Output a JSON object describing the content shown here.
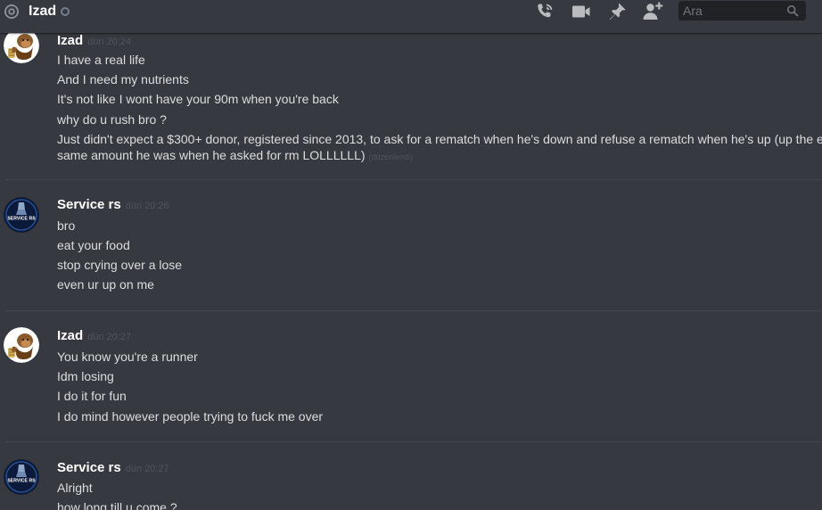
{
  "header": {
    "channel_name": "Izad",
    "status": "offline",
    "search_placeholder": "Ara",
    "icons": [
      "at-icon",
      "voice-call-icon",
      "video-call-icon",
      "pin-icon",
      "add-friend-icon",
      "search-icon"
    ]
  },
  "colors": {
    "background": "#36393f",
    "header_text": "#ffffff",
    "message_text": "#dcddde",
    "timestamp": "#4f545c",
    "icon": "#b9bbbe",
    "search_bg": "#202225"
  },
  "messages": [
    {
      "author": "Izad",
      "avatar": "ape-avatar",
      "timestamp": "dün 20:24",
      "lines": [
        "I have a real life",
        "And I need my nutrients",
        "It's not like I wont have your 90m when you're back",
        "why do u rush bro ?",
        "Just didn't expect a $300+ donor, registered since 2013, to ask for a rematch when he's down and refuse a rematch when he's up (up the e",
        "same amount he was when he asked for rm LOLLLLLL)"
      ],
      "edited_label": "(düzenlendi)"
    },
    {
      "author": "Service rs",
      "avatar": "service-rs-avatar",
      "avatar_text": "SERVICE RS",
      "timestamp": "dün 20:26",
      "lines": [
        "bro",
        "eat your food",
        "stop crying over a lose",
        "even ur up on me"
      ]
    },
    {
      "author": "Izad",
      "avatar": "ape-avatar",
      "timestamp": "dün 20:27",
      "lines": [
        "You know you're a runner",
        "Idm losing",
        "I do it for fun",
        "I do mind however people trying to fuck me over"
      ]
    },
    {
      "author": "Service rs",
      "avatar": "service-rs-avatar",
      "avatar_text": "SERVICE RS",
      "timestamp": "dün 20:27",
      "lines": [
        "Alright",
        "how long till u come ?"
      ]
    }
  ]
}
